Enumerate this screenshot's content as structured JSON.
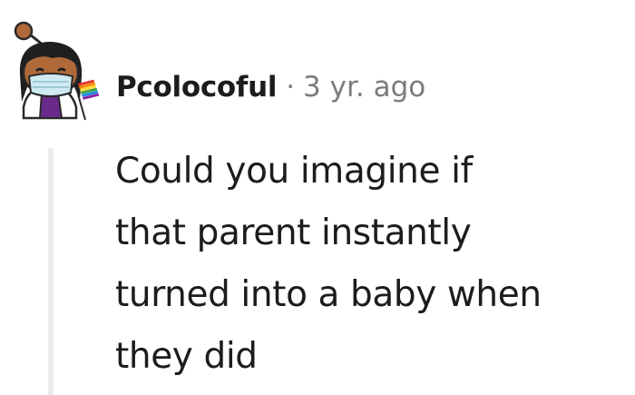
{
  "comment": {
    "author": "Pcolocoful",
    "separator": "·",
    "timestamp": "3 yr. ago",
    "body_lines": [
      "Could you imagine if",
      "that parent instantly",
      "turned into a baby when",
      "they did"
    ]
  },
  "avatar": {
    "icon": "snoo-avatar-icon",
    "colors": {
      "skin": "#b06a3a",
      "hair": "#1f1f1f",
      "mask": "#cfeaf2",
      "mask_outline": "#2a2a2a",
      "shirt": "#6a2a8c",
      "coat": "#ffffff"
    }
  },
  "colors": {
    "text": "#1c1c1c",
    "meta_text": "#7c7c7c",
    "thread_line": "#ebebeb",
    "background": "#ffffff"
  }
}
